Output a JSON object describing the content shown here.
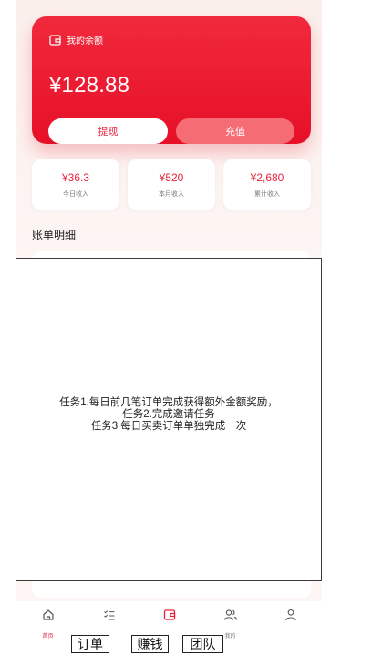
{
  "balance": {
    "title": "我的余额",
    "amount": "¥128.88",
    "withdraw_label": "提现",
    "recharge_label": "充值"
  },
  "stats": [
    {
      "value": "¥36.3",
      "label": "今日收入"
    },
    {
      "value": "¥520",
      "label": "本月收入"
    },
    {
      "value": "¥2,680",
      "label": "累计收入"
    }
  ],
  "bills": {
    "title": "账单明细"
  },
  "task_dialog": {
    "line1": "任务1.每日前几笔订单完成获得额外金额奖励，",
    "line2": "任务2.完成邀请任务",
    "line3": "任务3 每日买卖订单单独完成一次"
  },
  "tabbar": {
    "items": [
      {
        "label": "首页",
        "icon": "home-icon"
      },
      {
        "label": "",
        "icon": "task-list-icon"
      },
      {
        "label": "",
        "icon": "wallet-icon"
      },
      {
        "label": "我的",
        "icon": "team-icon"
      },
      {
        "label": "",
        "icon": "user-icon"
      }
    ]
  },
  "overlay_labels": {
    "orders": "订单",
    "earn": "赚钱",
    "team": "团队"
  },
  "colors": {
    "accent": "#e8213a",
    "card_gradient_top": "#f1293c",
    "card_gradient_bottom": "#e61028",
    "recharge_button": "#f66c74",
    "page_background": "#fdf6f4"
  }
}
